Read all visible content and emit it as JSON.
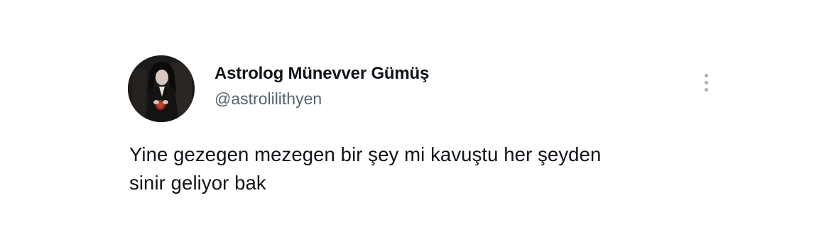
{
  "tweet": {
    "author": {
      "display_name": "Astrolog Münevver Gümüş",
      "handle": "@astrolilithyen",
      "avatar_icon": "profile-photo"
    },
    "more_icon": "more-vertical-icon",
    "text_lines": [
      "Yine gezegen mezegen bir şey mi kavuştu her şeyden",
      "sinir geliyor bak"
    ]
  },
  "colors": {
    "background": "#ffffff",
    "name": "#0f1419",
    "handle": "#536471",
    "icon": "#aab1b7"
  }
}
